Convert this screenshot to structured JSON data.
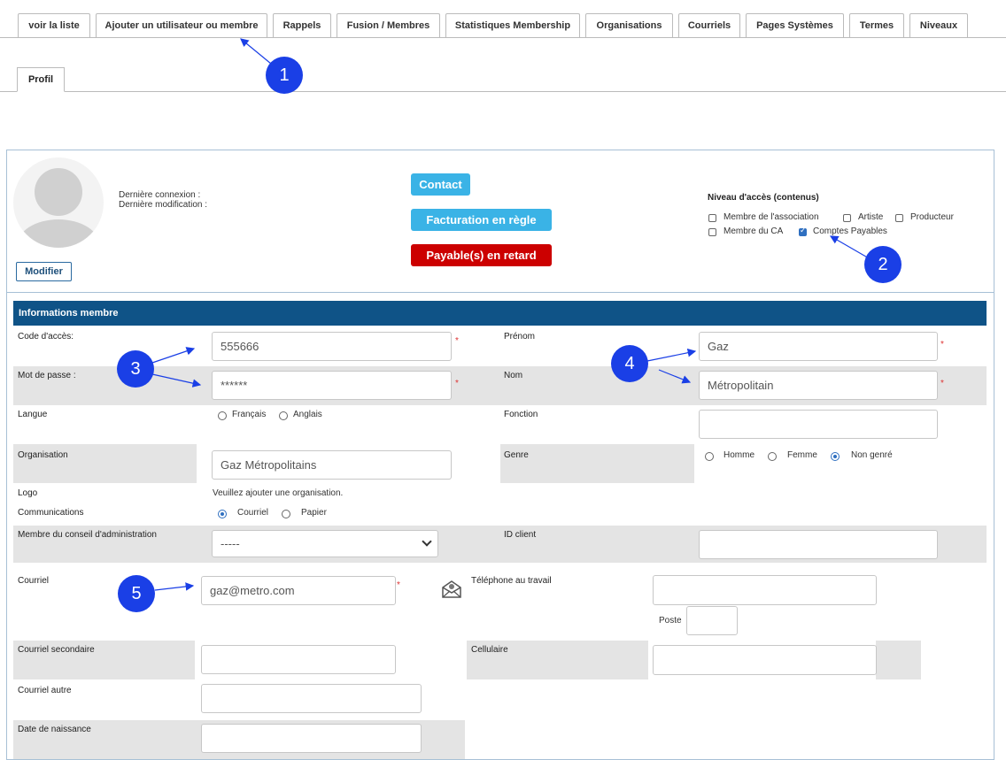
{
  "tabs": [
    "voir la liste",
    "Ajouter un utilisateur ou membre",
    "Rappels",
    "Fusion / Membres",
    "Statistiques Membership",
    "Organisations",
    "Courriels",
    "Pages Systèmes",
    "Termes",
    "Niveaux"
  ],
  "subtab": "Profil",
  "profile": {
    "last_login_label": "Dernière connexion :",
    "last_modified_label": "Dernière modification :",
    "edit_button": "Modifier",
    "contact_badge": "Contact",
    "billing_badge": "Facturation en règle",
    "late_badge": "Payable(s) en retard",
    "access_title": "Niveau d'accès (contenus)",
    "access_levels": [
      {
        "label": "Membre de l'association",
        "checked": false
      },
      {
        "label": "Artiste",
        "checked": false
      },
      {
        "label": "Producteur",
        "checked": false
      },
      {
        "label": "Membre du CA",
        "checked": false
      },
      {
        "label": "Comptes Payables",
        "checked": true
      }
    ]
  },
  "section_title": "Informations membre",
  "fields": {
    "access_code_label": "Code d'accès:",
    "access_code_value": "555666",
    "password_label": "Mot de passe :",
    "password_value": "******",
    "language_label": "Langue",
    "lang_fr": "Français",
    "lang_en": "Anglais",
    "organisation_label": "Organisation",
    "organisation_value": "Gaz Métropolitains",
    "logo_label": "Logo",
    "logo_note": "Veuillez ajouter une organisation.",
    "communications_label": "Communications",
    "comm_email": "Courriel",
    "comm_paper": "Papier",
    "board_label": "Membre du conseil d'administration",
    "board_value": "-----",
    "email_label": "Courriel",
    "email_value": "gaz@metro.com",
    "secondary_email_label": "Courriel secondaire",
    "other_email_label": "Courriel autre",
    "birthdate_label": "Date de naissance",
    "firstname_label": "Prénom",
    "firstname_value": "Gaz",
    "lastname_label": "Nom",
    "lastname_value": "Métropolitain",
    "function_label": "Fonction",
    "gender_label": "Genre",
    "gender_male": "Homme",
    "gender_female": "Femme",
    "gender_nb": "Non genré",
    "client_id_label": "ID client",
    "work_phone_label": "Téléphone au travail",
    "extension_label": "Poste",
    "mobile_label": "Cellulaire"
  },
  "callouts": [
    "1",
    "2",
    "3",
    "4",
    "5"
  ],
  "colors": {
    "contact": "#3ab3e6",
    "billing": "#3ab3e6",
    "late": "#cc0000",
    "header": "#0f5387",
    "callout": "#1a3fe6"
  }
}
